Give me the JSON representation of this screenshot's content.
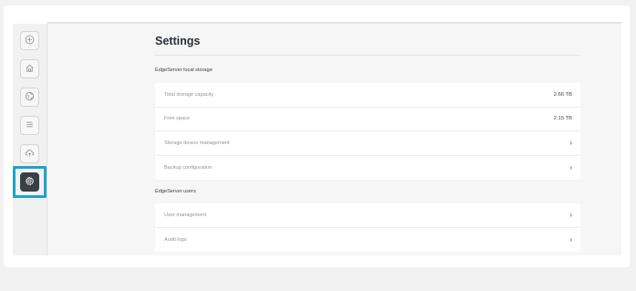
{
  "page": {
    "title": "Settings"
  },
  "sidebar": {
    "items": [
      {
        "name": "plus-circle-icon",
        "active": false
      },
      {
        "name": "home-icon",
        "active": false
      },
      {
        "name": "globe-icon",
        "active": false
      },
      {
        "name": "list-icon",
        "active": false
      },
      {
        "name": "cloud-upload-icon",
        "active": false
      },
      {
        "name": "gear-icon",
        "active": true
      }
    ]
  },
  "sections": [
    {
      "label": "EdgeServer local storage",
      "rows": [
        {
          "label": "Total storage capacity",
          "value": "2.66 TB"
        },
        {
          "label": "Free space",
          "value": "2.15 TB"
        },
        {
          "label": "Storage device management",
          "value": "›"
        },
        {
          "label": "Backup configuration",
          "value": "›"
        }
      ]
    },
    {
      "label": "EdgeServer users",
      "rows": [
        {
          "label": "User management",
          "value": "›"
        },
        {
          "label": "Audit logs",
          "value": "›"
        }
      ]
    }
  ],
  "colors": {
    "accent_highlight": "#1ea3c8",
    "active_button": "#3a3f47",
    "title_text": "#2a2e35",
    "muted_text": "#8f939a"
  }
}
